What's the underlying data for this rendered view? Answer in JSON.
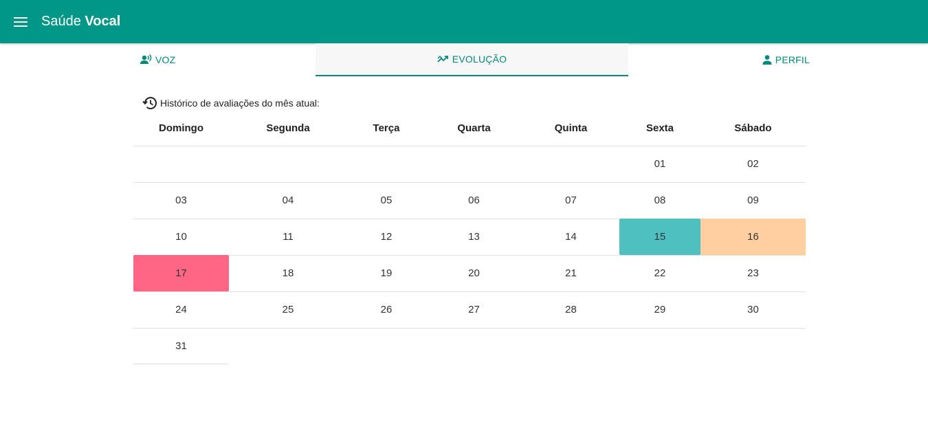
{
  "appbar": {
    "title_regular": "Saúde ",
    "title_bold": "Vocal",
    "menu_icon": "menu-icon",
    "background": "#009688"
  },
  "tabs": [
    {
      "label": "VOZ",
      "icon": "record-voice-icon",
      "selected": false
    },
    {
      "label": "EVOLUÇÃO",
      "icon": "trending-icon",
      "selected": true
    },
    {
      "label": "PERFIL",
      "icon": "person-icon",
      "selected": false
    }
  ],
  "history": {
    "title": "Histórico de avaliações do mês atual:",
    "icon": "history-icon"
  },
  "calendar": {
    "weekdays": [
      "Domingo",
      "Segunda",
      "Terça",
      "Quarta",
      "Quinta",
      "Sexta",
      "Sábado"
    ],
    "weeks": [
      [
        "",
        "",
        "",
        "",
        "",
        "01",
        "02"
      ],
      [
        "03",
        "04",
        "05",
        "06",
        "07",
        "08",
        "09"
      ],
      [
        "10",
        "11",
        "12",
        "13",
        "14",
        "15",
        "16"
      ],
      [
        "17",
        "18",
        "19",
        "20",
        "21",
        "22",
        "23"
      ],
      [
        "24",
        "25",
        "26",
        "27",
        "28",
        "29",
        "30"
      ],
      [
        "31",
        "",
        "",
        "",
        "",
        "",
        ""
      ]
    ],
    "highlights": [
      {
        "day": "15",
        "color": "#4ec0c0"
      },
      {
        "day": "16",
        "color": "#ffcfa0"
      },
      {
        "day": "17",
        "color": "#ff6685"
      }
    ]
  },
  "colors": {
    "accent": "#00897b",
    "divider": "#e0e0e0"
  }
}
